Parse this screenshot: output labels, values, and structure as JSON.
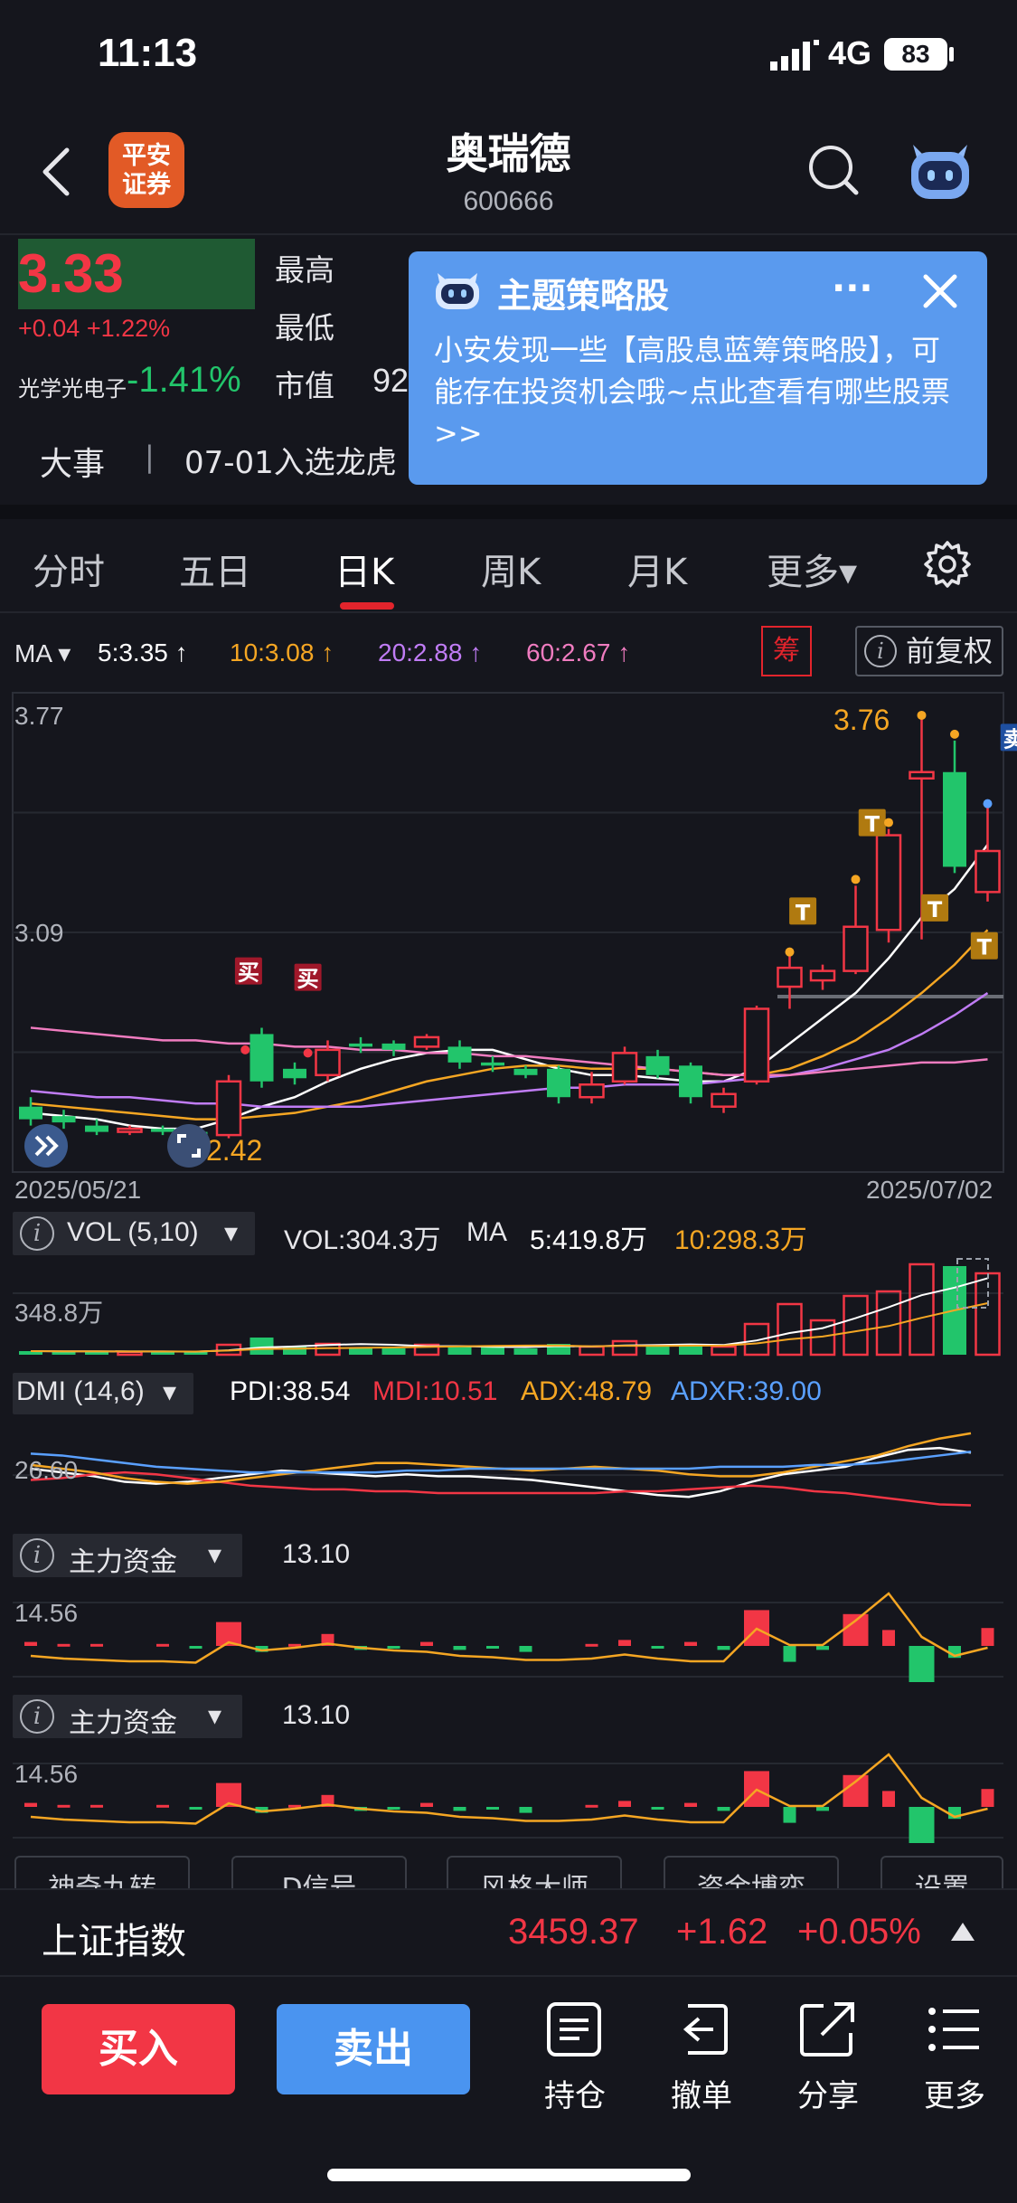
{
  "status": {
    "time": "11:13",
    "network": "4G",
    "battery": "83"
  },
  "header": {
    "broker_logo": [
      "平安",
      "证券"
    ],
    "stock_name": "奥瑞德",
    "stock_code": "600666"
  },
  "quote": {
    "price": "3.33",
    "change": "+0.04 +1.22%",
    "sector_name": "光学光电子",
    "sector_change": "-1.41%",
    "labels": {
      "high": "最高",
      "low": "最低",
      "market_value": "市值"
    },
    "market_value_partial": "92"
  },
  "popup": {
    "title": "主题策略股",
    "more": "···",
    "body": "小安发现一些【高股息蓝筹策略股】，可能存在投资机会哦~点此查看有哪些股票>>"
  },
  "event": {
    "label": "大事",
    "separator": "|",
    "text": "07-01入选龙虎"
  },
  "tabs": [
    {
      "label": "分时",
      "active": false
    },
    {
      "label": "五日",
      "active": false
    },
    {
      "label": "日K",
      "active": true
    },
    {
      "label": "周K",
      "active": false
    },
    {
      "label": "月K",
      "active": false
    },
    {
      "label": "更多▾",
      "active": false
    }
  ],
  "ma_legend": {
    "prefix": "MA ▾",
    "items": [
      {
        "text": "5:3.35 ↑",
        "color": "#ffffff"
      },
      {
        "text": "10:3.08 ↑",
        "color": "#f5a623"
      },
      {
        "text": "20:2.88 ↑",
        "color": "#c07cf5"
      },
      {
        "text": "60:2.67 ↑",
        "color": "#f07cc0"
      }
    ],
    "chip_label": "筹",
    "adjust_label": "前复权"
  },
  "chart_data": [
    {
      "type": "candlestick",
      "title": "",
      "y_labels": [
        "3.77",
        "3.09",
        "2.42"
      ],
      "ylim": [
        2.42,
        3.77
      ],
      "x_labels": [
        "2025/05/21",
        "2025/07/02"
      ],
      "max_label": "3.76",
      "min_label": "2.42",
      "signals": {
        "buy": "买",
        "sell": "卖",
        "t": "T"
      },
      "candles": [
        {
          "o": 2.52,
          "c": 2.48,
          "h": 2.55,
          "l": 2.46
        },
        {
          "o": 2.49,
          "c": 2.47,
          "h": 2.51,
          "l": 2.45
        },
        {
          "o": 2.46,
          "c": 2.44,
          "h": 2.48,
          "l": 2.43
        },
        {
          "o": 2.44,
          "c": 2.45,
          "h": 2.46,
          "l": 2.43
        },
        {
          "o": 2.45,
          "c": 2.44,
          "h": 2.46,
          "l": 2.43
        },
        {
          "o": 2.44,
          "c": 2.43,
          "h": 2.45,
          "l": 2.42
        },
        {
          "o": 2.43,
          "c": 2.6,
          "h": 2.62,
          "l": 2.42
        },
        {
          "o": 2.75,
          "c": 2.6,
          "h": 2.77,
          "l": 2.58
        },
        {
          "o": 2.64,
          "c": 2.61,
          "h": 2.66,
          "l": 2.59
        },
        {
          "o": 2.62,
          "c": 2.7,
          "h": 2.73,
          "l": 2.6
        },
        {
          "o": 2.72,
          "c": 2.71,
          "h": 2.74,
          "l": 2.69
        },
        {
          "o": 2.72,
          "c": 2.7,
          "h": 2.73,
          "l": 2.68
        },
        {
          "o": 2.71,
          "c": 2.74,
          "h": 2.75,
          "l": 2.7
        },
        {
          "o": 2.71,
          "c": 2.66,
          "h": 2.73,
          "l": 2.64
        },
        {
          "o": 2.66,
          "c": 2.65,
          "h": 2.68,
          "l": 2.63
        },
        {
          "o": 2.64,
          "c": 2.62,
          "h": 2.65,
          "l": 2.61
        },
        {
          "o": 2.64,
          "c": 2.55,
          "h": 2.65,
          "l": 2.53
        },
        {
          "o": 2.55,
          "c": 2.59,
          "h": 2.63,
          "l": 2.53
        },
        {
          "o": 2.6,
          "c": 2.69,
          "h": 2.71,
          "l": 2.59
        },
        {
          "o": 2.68,
          "c": 2.62,
          "h": 2.7,
          "l": 2.61
        },
        {
          "o": 2.65,
          "c": 2.55,
          "h": 2.66,
          "l": 2.53
        },
        {
          "o": 2.52,
          "c": 2.56,
          "h": 2.58,
          "l": 2.5
        },
        {
          "o": 2.6,
          "c": 2.83,
          "h": 2.84,
          "l": 2.59
        },
        {
          "o": 2.9,
          "c": 2.96,
          "h": 3.0,
          "l": 2.83
        },
        {
          "o": 2.92,
          "c": 2.95,
          "h": 2.97,
          "l": 2.89
        },
        {
          "o": 2.95,
          "c": 3.09,
          "h": 3.22,
          "l": 2.94
        },
        {
          "o": 3.08,
          "c": 3.38,
          "h": 3.4,
          "l": 3.04
        },
        {
          "o": 3.56,
          "c": 3.58,
          "h": 3.76,
          "l": 3.05
        },
        {
          "o": 3.58,
          "c": 3.28,
          "h": 3.68,
          "l": 3.26
        },
        {
          "o": 3.2,
          "c": 3.33,
          "h": 3.48,
          "l": 3.17
        }
      ],
      "ma": {
        "ma5": [
          2.5,
          2.49,
          2.48,
          2.46,
          2.45,
          2.45,
          2.48,
          2.52,
          2.55,
          2.6,
          2.64,
          2.67,
          2.69,
          2.7,
          2.7,
          2.67,
          2.64,
          2.62,
          2.62,
          2.61,
          2.6,
          2.6,
          2.64,
          2.72,
          2.8,
          2.88,
          2.99,
          3.12,
          3.21,
          3.35
        ],
        "ma10": [
          2.53,
          2.52,
          2.51,
          2.5,
          2.49,
          2.48,
          2.48,
          2.49,
          2.5,
          2.52,
          2.54,
          2.57,
          2.6,
          2.62,
          2.64,
          2.65,
          2.65,
          2.64,
          2.64,
          2.64,
          2.63,
          2.62,
          2.62,
          2.64,
          2.68,
          2.73,
          2.8,
          2.88,
          2.97,
          3.08
        ],
        "ma20": [
          2.57,
          2.56,
          2.55,
          2.55,
          2.54,
          2.53,
          2.53,
          2.52,
          2.52,
          2.52,
          2.52,
          2.53,
          2.54,
          2.55,
          2.56,
          2.57,
          2.58,
          2.58,
          2.59,
          2.59,
          2.59,
          2.6,
          2.61,
          2.62,
          2.64,
          2.67,
          2.7,
          2.75,
          2.81,
          2.88
        ],
        "ma60": [
          2.77,
          2.76,
          2.75,
          2.74,
          2.73,
          2.73,
          2.72,
          2.72,
          2.71,
          2.71,
          2.7,
          2.7,
          2.69,
          2.69,
          2.68,
          2.68,
          2.67,
          2.66,
          2.65,
          2.64,
          2.63,
          2.62,
          2.62,
          2.62,
          2.63,
          2.64,
          2.65,
          2.66,
          2.66,
          2.67
        ]
      }
    },
    {
      "type": "bar",
      "title": "VOL (5,10)",
      "summary": {
        "vol": "VOL:304.3万",
        "ma_prefix": "MA",
        "ma5": "5:419.8万",
        "ma10": "10:298.3万"
      },
      "y_label": "348.8万",
      "values": [
        40,
        35,
        38,
        32,
        36,
        30,
        110,
        190,
        90,
        120,
        80,
        70,
        110,
        95,
        80,
        70,
        120,
        90,
        150,
        110,
        100,
        90,
        340,
        560,
        380,
        650,
        700,
        1000,
        980,
        900
      ]
    },
    {
      "type": "line",
      "title": "DMI (14,6)",
      "summary": {
        "pdi": "PDI:38.54",
        "mdi": "MDI:10.51",
        "adx": "ADX:48.79",
        "adxr": "ADXR:39.00"
      },
      "y_label": "26.60",
      "series": [
        {
          "name": "PDI",
          "color": "#ffffff",
          "values": [
            30,
            28,
            26,
            23,
            22,
            23,
            25,
            27,
            29,
            28,
            27,
            26,
            27,
            26,
            26,
            25,
            24,
            22,
            20,
            18,
            16,
            15,
            18,
            23,
            27,
            29,
            31,
            36,
            40,
            41,
            38.5
          ]
        },
        {
          "name": "MDI",
          "color": "#f23645",
          "values": [
            24,
            25,
            27,
            28,
            27,
            25,
            23,
            21,
            20,
            19,
            19,
            18,
            18,
            17,
            17,
            17,
            17,
            17,
            17,
            18,
            18,
            19,
            20,
            21,
            20,
            18,
            17,
            15,
            13,
            11,
            10.5
          ]
        },
        {
          "name": "ADX",
          "color": "#f5a623",
          "values": [
            32,
            30,
            28,
            25,
            23,
            22,
            23,
            25,
            27,
            29,
            31,
            33,
            33,
            32,
            31,
            30,
            29,
            30,
            31,
            30,
            29,
            27,
            26,
            26,
            28,
            31,
            34,
            37,
            42,
            46,
            48.8
          ]
        },
        {
          "name": "ADXR",
          "color": "#5aa0ff",
          "values": [
            38,
            37,
            35,
            33,
            31,
            30,
            29,
            28,
            28,
            28,
            28,
            28,
            29,
            29,
            30,
            30,
            30,
            30,
            30,
            30,
            30,
            30,
            31,
            31,
            31,
            32,
            32,
            33,
            35,
            37,
            39
          ]
        }
      ]
    },
    {
      "type": "bar+line",
      "title": "主力资金",
      "summary": {
        "value": "13.10"
      },
      "y_label": "14.56",
      "bars": [
        0.2,
        0.1,
        0.1,
        0,
        0.1,
        -0.1,
        1.2,
        -0.3,
        0.1,
        0.6,
        -0.2,
        -0.1,
        0.2,
        -0.2,
        -0.1,
        -0.3,
        0,
        0.1,
        0.3,
        -0.1,
        0.2,
        -0.2,
        1.8,
        -0.8,
        -0.2,
        1.6,
        0.8,
        -1.9,
        -0.6,
        0.9
      ],
      "line": [
        0.5,
        0.4,
        0.35,
        0.3,
        0.3,
        0.25,
        1.0,
        0.7,
        0.8,
        0.95,
        0.8,
        0.7,
        0.65,
        0.5,
        0.45,
        0.35,
        0.35,
        0.4,
        0.55,
        0.4,
        0.3,
        0.3,
        1.5,
        0.9,
        0.9,
        1.8,
        2.8,
        1.2,
        0.5,
        0.8
      ]
    },
    {
      "type": "bar+line",
      "title": "主力资金",
      "summary": {
        "value": "13.10"
      },
      "y_label": "14.56",
      "bars": [
        0.2,
        0.1,
        0.1,
        0,
        0.1,
        -0.1,
        1.2,
        -0.3,
        0.1,
        0.6,
        -0.2,
        -0.1,
        0.2,
        -0.2,
        -0.1,
        -0.3,
        0,
        0.1,
        0.3,
        -0.1,
        0.2,
        -0.2,
        1.8,
        -0.8,
        -0.2,
        1.6,
        0.8,
        -1.9,
        -0.6,
        0.9
      ],
      "line": [
        0.5,
        0.4,
        0.35,
        0.3,
        0.3,
        0.25,
        1.0,
        0.7,
        0.8,
        0.95,
        0.8,
        0.7,
        0.65,
        0.5,
        0.45,
        0.35,
        0.35,
        0.4,
        0.55,
        0.4,
        0.3,
        0.3,
        1.5,
        0.9,
        0.9,
        1.8,
        2.8,
        1.2,
        0.5,
        0.8
      ]
    }
  ],
  "tools": [
    "神奇九转",
    "D信号",
    "风格大师",
    "资金博弈",
    "设置"
  ],
  "index": {
    "name": "上证指数",
    "value": "3459.37",
    "change": "+1.62",
    "pct": "+0.05%"
  },
  "bottom": {
    "buy": "买入",
    "sell": "卖出",
    "actions": [
      {
        "label": "持仓",
        "icon": "holdings-icon"
      },
      {
        "label": "撤单",
        "icon": "cancel-order-icon"
      },
      {
        "label": "分享",
        "icon": "share-icon"
      },
      {
        "label": "更多",
        "icon": "menu-icon"
      }
    ]
  },
  "colors": {
    "up": "#f23645",
    "down": "#22c56b",
    "bg": "#15161d",
    "accent": "#4a94f0"
  }
}
